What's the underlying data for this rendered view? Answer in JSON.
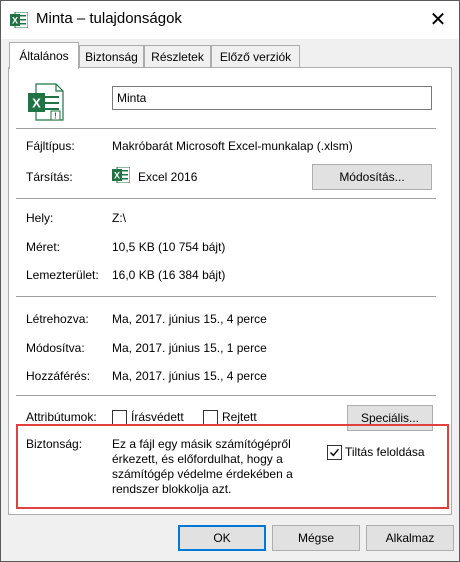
{
  "window": {
    "title": "Minta – tulajdonságok",
    "close_glyph": "✕"
  },
  "tabs": [
    {
      "label": "Általános",
      "active": true
    },
    {
      "label": "Biztonság",
      "active": false
    },
    {
      "label": "Részletek",
      "active": false
    },
    {
      "label": "Előző verziók",
      "active": false
    }
  ],
  "file": {
    "name": "Minta",
    "icon": "excel-macro-file-icon"
  },
  "rows": {
    "filetype_label": "Fájltípus:",
    "filetype_value": "Makróbarát Microsoft Excel-munkalap (.xlsm)",
    "opens_label": "Társítás:",
    "opens_value": "Excel 2016",
    "change_button": "Módosítás...",
    "location_label": "Hely:",
    "location_value": "Z:\\",
    "size_label": "Méret:",
    "size_value": "10,5 KB (10 754 bájt)",
    "disksize_label": "Lemezterület:",
    "disksize_value": "16,0 KB (16 384 bájt)",
    "created_label": "Létrehozva:",
    "created_value": "Ma, 2017. június 15., 4 perce",
    "modified_label": "Módosítva:",
    "modified_value": "Ma, 2017. június 15., 1 perce",
    "accessed_label": "Hozzáférés:",
    "accessed_value": "Ma, 2017. június 15., 4 perce",
    "attributes_label": "Attribútumok:",
    "readonly_label": "Írásvédett",
    "readonly_checked": false,
    "hidden_label": "Rejtett",
    "hidden_checked": false,
    "advanced_button": "Speciális..."
  },
  "security": {
    "label": "Biztonság:",
    "line1": "Ez a fájl egy másik számítógépről",
    "line2": "érkezett, és előfordulhat, hogy a",
    "line3": "számítógép védelme érdekében a",
    "line4": "rendszer blokkolja azt.",
    "unblock_label": "Tiltás feloldása",
    "unblock_checked": true
  },
  "footer": {
    "ok": "OK",
    "cancel": "Mégse",
    "apply": "Alkalmaz"
  },
  "colors": {
    "excel_green": "#217346",
    "highlight_red": "#e04040",
    "focus_blue": "#0078d7"
  }
}
